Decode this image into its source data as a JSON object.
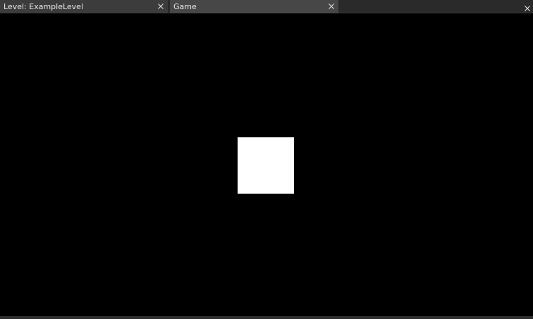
{
  "tabs": [
    {
      "label": "Level: ExampleLevel",
      "close_icon": "close-icon"
    },
    {
      "label": "Game",
      "close_icon": "close-icon"
    }
  ],
  "pane": {
    "close_icon": "close-icon"
  },
  "viewport": {
    "background": "#000000",
    "entity": {
      "shape": "square",
      "color": "#ffffff"
    }
  },
  "colors": {
    "tabbar_bg": "#2a2a2a",
    "tab_bg": "#3c3c3c",
    "active_tab_bg": "#474747",
    "text": "#e6e6e6"
  }
}
